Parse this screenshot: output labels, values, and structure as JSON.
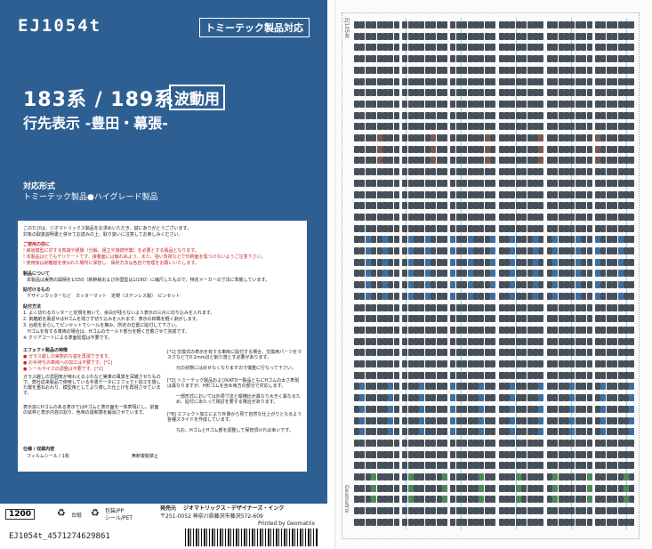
{
  "cover": {
    "code": "EJ1054t",
    "badge": "トミーテック製品対応",
    "title1": "183系 / 189系",
    "tag": "波動用",
    "title2": "行先表示 -豊田・幕張-",
    "compat_head": "対応形式",
    "compat_body": "トミーテック製品●ハイグレード製品"
  },
  "card": {
    "intro1": "このたびは、ジオマトリックス製品をお求めいただき、誠にありがとうございます。",
    "intro2": "対象の取扱説明書と併せてお読みの上、取り扱いに注意してお楽しみください。",
    "caution_head": "ご使用の前に",
    "caution1": "! 鉄道模型に対する知識や経験（分解、組立や接続作業）を必要とする製品となります。",
    "caution2": "! 本製品はとてもデリケートです。接着面には触れぬよう、また、強い負荷などで印刷面を傷つけないようご注意下さい。",
    "caution3": "! 使用後は剥離紙を使われた場所に保管し、保存方法は各自で管理をお願いいたします。",
    "spec_head": "製品について",
    "spec1": "本製品は実際の図柄を1/150（新幹線および外国型は1/160）に縮尺したもので、特定メーカーの寸法に準拠しています。",
    "tools_head": "貼付けるもの",
    "tools1": "デザインカッターなど　カッターマット　定規（ステンレス製）　ピンセット",
    "method_head": "貼付方法",
    "method1": "1. よく切れるカッターと定規を用いて、余白が残らないよう表示の三片に切り込みを入れます。",
    "method2": "2. 剥離紙を裏返せばHゴムを残さず切り込みを入れます。表示の四隅を軽く剥がします。",
    "method3": "3. 台紙を反らしてピンセットでシールを摘み、所定の位置に貼付して下さい。",
    "method4": "　Hゴムを有する車両の場合は、Hゴムのモールド部分を軽く圧着させて完成です。",
    "method5": "※ クリアコートによる表面処理は不要です。",
    "effect_head": "エフェクト製品の特徴",
    "effect1": "● ガラス越しの実態的な姿を再現できます。",
    "effect2": "● お手持ちの車両への加工は不要です。[*1]",
    "effect3": "● シールサイズの調整は不要です。[*2]",
    "effect4": "ガラス越しの雰囲気が味わえるぶれなど実車の風景を深雑させたもので、弊社従来製品で使用している手書データにエフェクト加工を施した層を重ねおわり、模型用としてより適した仕上げを再現させています。",
    "effect5": "表示窓にHゴムのある表示ではHゴムと表示面を一体表現にし、前面の窓枠と表示内容の割り、色味の違和感を解消させています。",
    "note1": "[*1] 交換式の表示を有する車両に貼付する場合、交換用パーツをマスクなどで0.2mmほど削り落とす必要があります。",
    "note1b": "元の状態には戻せなくなりますので慎重に行なって下さい。",
    "note2": "[*2] トミーテック製品およびKATO一製品ともにHゴムの太さ表現は異なりますが、H形ゴムを含め両方の部分で対応します。",
    "note2b": "一部形式においては外周寸法と縦横比が異なり大きく異なるため、貼付にあたって検討を要する場合があります。",
    "note3": "[*B] エフェクト加工により外側から見て自然な仕上がりとなるよう各種スライドを作成しています。",
    "note3b": "なお、HゴムとHゴム部を調整して保管頂ければ幸いです。",
    "pack_head": "仕様 / 収録内容",
    "pack1": "フィルムシール / 1枚",
    "pack2": "無断複製禁止"
  },
  "strip": {
    "price": "1200",
    "paper": "台紙",
    "paper_mat": "包装/PP",
    "seal_mat": "シール/PET",
    "pub_head": "発売元",
    "pub_name": "ジオマトリックス・デザイナーズ・インク",
    "pub_addr": "〒251-0052 神奈川県藤沢市藤沢572-609",
    "printed": "Printed by Geomatrix"
  },
  "ean": "EJ1054t_4571274629861",
  "sheet": {
    "label_top": "EJ1054t",
    "label_bottom": "Geomatrix"
  },
  "colors": {
    "cover_blue": "#2e5f92",
    "plate_dark": "#46505a",
    "plate_blue": "#3d6fa0",
    "plate_green": "#4a8a58",
    "plate_brown": "#7a5a50",
    "guide_line": "#9ad2dd"
  }
}
